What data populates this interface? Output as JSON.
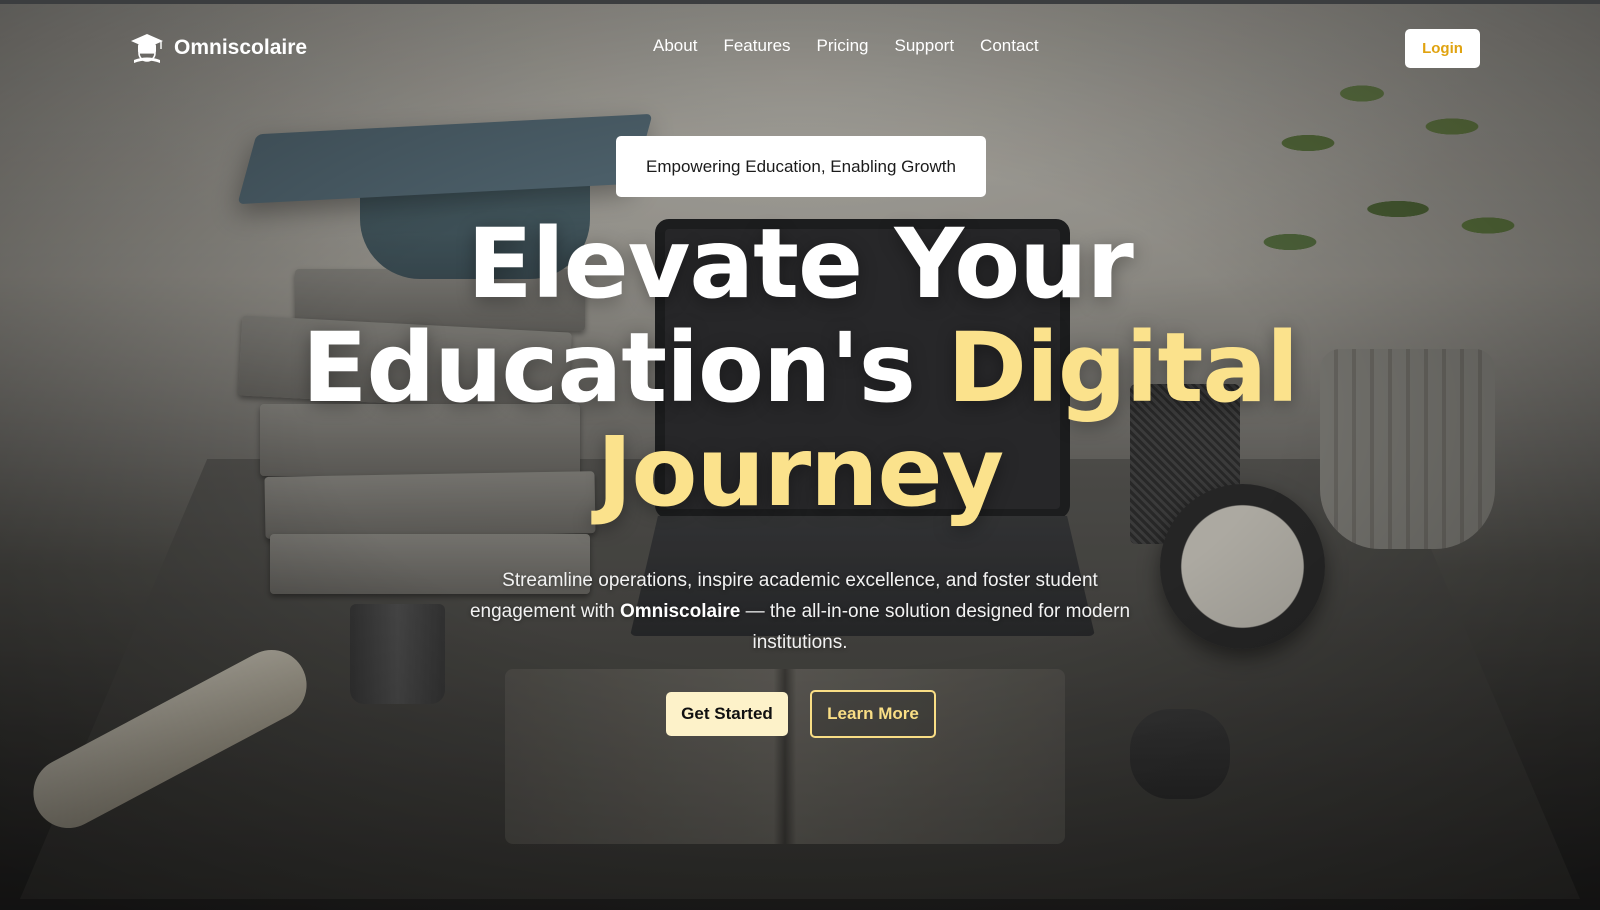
{
  "nav": {
    "brand": "Omniscolaire",
    "brand_icon": "graduation-cap-globe-icon",
    "links": [
      "About",
      "Features",
      "Pricing",
      "Support",
      "Contact"
    ],
    "login_label": "Login"
  },
  "hero": {
    "badge": "Empowering Education, Enabling Growth",
    "headline_line1": "Elevate Your",
    "headline_line2_white": "Education's",
    "headline_line2_accent": "Digital",
    "headline_line3_accent": "Journey",
    "subtext_before": "Streamline operations, inspire academic excellence, and foster student engagement with",
    "subtext_bold": "Omniscolaire",
    "subtext_after": "— the all-in-one solution designed for modern institutions.",
    "primary_cta": "Get Started",
    "secondary_cta": "Learn More"
  },
  "colors": {
    "accent": "#fbe28c",
    "login_text": "#e0a310",
    "primary_button_bg": "#fdf2c9"
  }
}
